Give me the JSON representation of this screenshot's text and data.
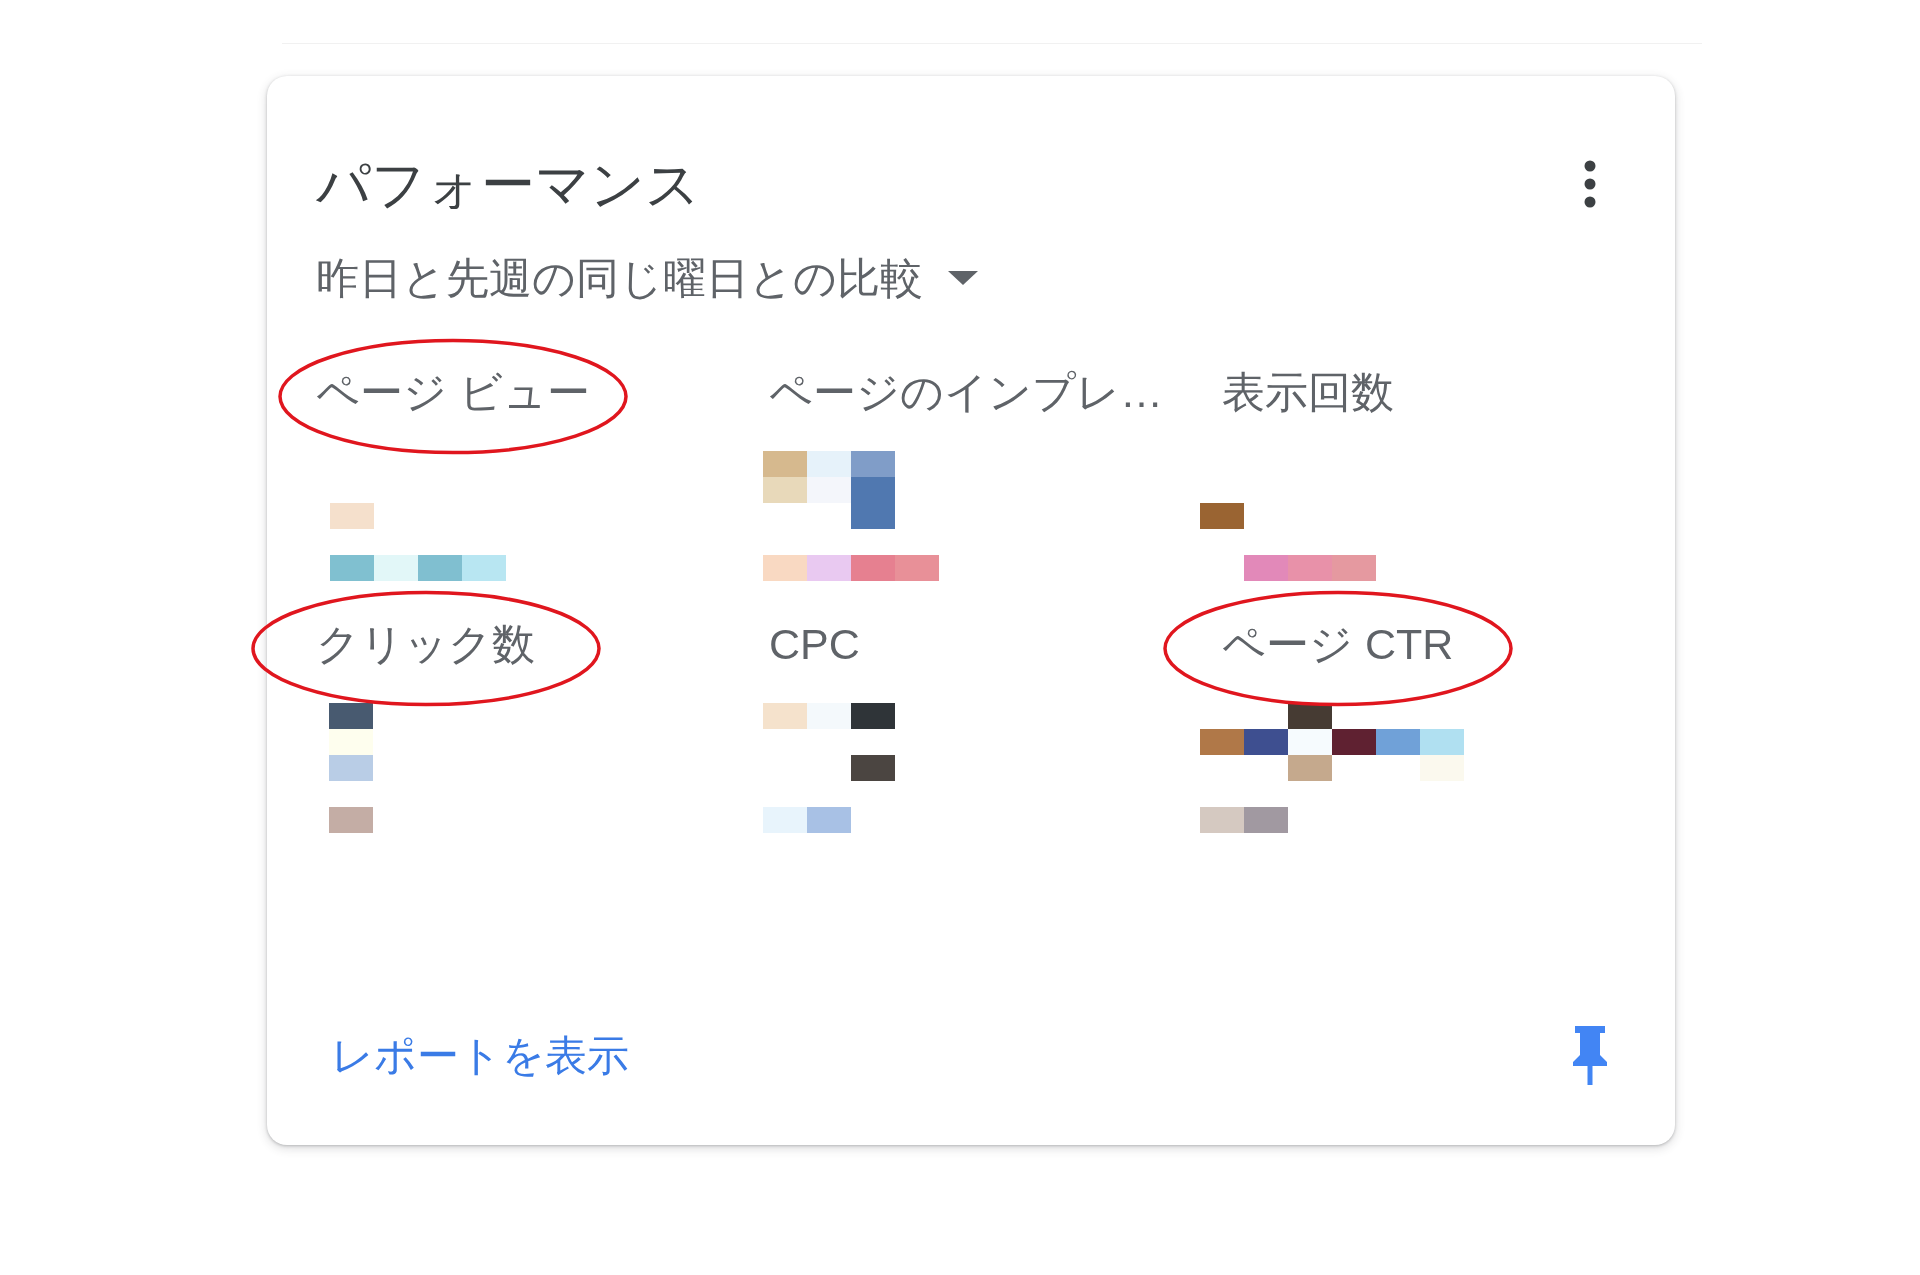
{
  "card": {
    "title": "パフォーマンス",
    "comparison": "昨日と先週の同じ曜日との比較",
    "metrics": [
      {
        "label": "ページ ビュー",
        "circled": true,
        "pixelated": true
      },
      {
        "label": "ページのインプレ…",
        "circled": false,
        "pixelated": true
      },
      {
        "label": "表示回数",
        "circled": false,
        "pixelated": true
      },
      {
        "label": "クリック数",
        "circled": true,
        "pixelated": true
      },
      {
        "label": "CPC",
        "circled": false,
        "pixelated": true
      },
      {
        "label": "ページ CTR",
        "circled": true,
        "pixelated": true
      }
    ],
    "report_link": "レポートを表示"
  }
}
